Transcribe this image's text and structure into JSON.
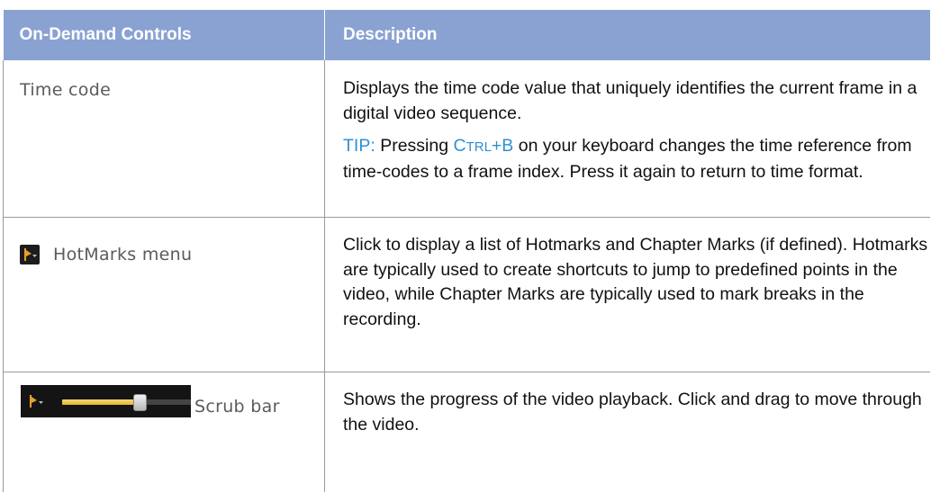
{
  "table": {
    "headers": [
      "On-Demand Controls",
      "Description"
    ],
    "rows": [
      {
        "control": "Time code",
        "description": "Displays the time code value that uniquely identifies the current frame in a digital video sequence.",
        "tip": {
          "label": "TIP:",
          "text_before": "Pressing",
          "key_first": "C",
          "key_small": "TRL",
          "key_rest": "+B",
          "text_after": "on your keyboard changes the time reference from time-codes to a frame index. Press it again to return to time format."
        }
      },
      {
        "control": "HotMarks menu",
        "icon": "hotmarks-icon",
        "description": "Click to display a list of Hotmarks and Chapter Marks (if defined). Hotmarks are typically used to create shortcuts to jump to predefined points in the video, while Chapter Marks are typically used to mark breaks in the recording."
      },
      {
        "control": "Scrub bar",
        "icon": "scrub-bar-icon",
        "scrub_progress_fraction": 0.55,
        "description": "Shows the progress of the video playback. Click and drag to move through the video."
      }
    ]
  },
  "colors": {
    "header_bg": "#8aa2d2",
    "header_text": "#ffffff",
    "tip_accent": "#2f8fd4",
    "control_text": "#5b5b5b",
    "hotmark_orange": "#e8a02a",
    "scrub_fill": "#e5b930"
  }
}
